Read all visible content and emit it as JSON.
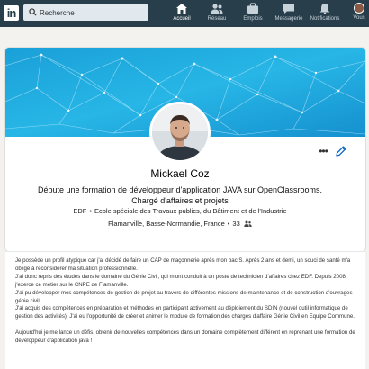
{
  "nav": {
    "logo_text": "in",
    "search_placeholder": "Recherche",
    "items": [
      {
        "label": "Accueil",
        "icon": "home-icon"
      },
      {
        "label": "Réseau",
        "icon": "network-icon"
      },
      {
        "label": "Emplois",
        "icon": "jobs-icon"
      },
      {
        "label": "Messagerie",
        "icon": "messaging-icon"
      },
      {
        "label": "Notifications",
        "icon": "notifications-icon"
      }
    ],
    "me_label": "Vous",
    "colors": {
      "bar": "#283e4a",
      "search": "#e1e9ee",
      "icon": "#c7d1d8"
    }
  },
  "profile": {
    "name": "Mickael Coz",
    "headline_line1": "Débute une formation de développeur d'application JAVA sur OpenClassrooms.",
    "headline_line2": "Chargé d'affaires et projets",
    "company": "EDF",
    "school": "Ecole spéciale des Travaux publics, du Bâtiment et de l'Industrie",
    "location": "Flamanville, Basse-Normandie, France",
    "connections": "33",
    "separator": "•",
    "more_label": "•••",
    "accent_color": "#0a66c2"
  },
  "summary": {
    "paragraphs": [
      "Je possède un profil atypique car j'ai décidé de faire un CAP de maçonnerie après mon bac S. Après 2 ans et demi, un souci de santé m'a obligé à reconsidérer ma situation professionnelle.",
      "J'ai donc repris des études dans le domaine du Génie Civil, qui m'ont conduit à un poste de technicien d'affaires chez EDF. Depuis 2008, j'exerce ce métier sur le CNPE de Flamanville.",
      "J'ai pu développer mes compétences de gestion de projet au travers de différentes missions de maintenance et de construction d'ouvrages génie civil.",
      "J'ai acquis des compétences en préparation et méthodes en participant activement au déploiement du SDIN (nouvel outil informatique de gestion des activités). J'ai eu l'opportunité de créer et animer le module de formation des chargés d'affaire Génie Civil en Equipe Commune.",
      "",
      "Aujourd'hui je me lance un défis, obtenir de nouvelles compétences dans un domaine complètement différent en reprenant une formation de développeur d'application java !"
    ]
  }
}
